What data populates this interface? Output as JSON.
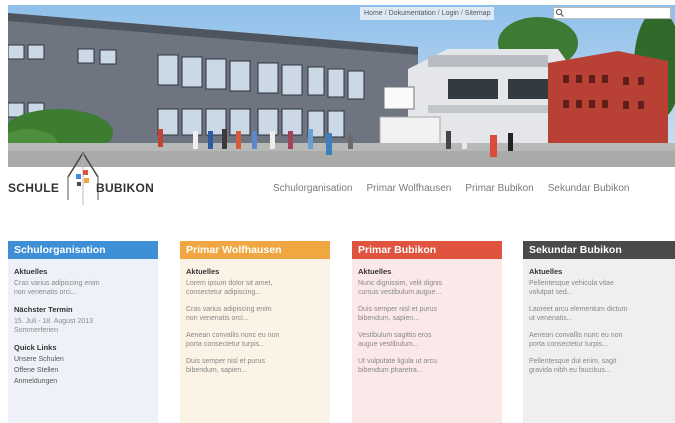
{
  "topnav": {
    "items": [
      "Home",
      "Dokumentation",
      "Login",
      "Sitemap"
    ],
    "separator": "/"
  },
  "search": {
    "placeholder": "",
    "icon": "search-icon"
  },
  "brand": {
    "left": "SCHULE",
    "right": "BUBIKON"
  },
  "mainnav": [
    "Schulorganisation",
    "Primar Wolfhausen",
    "Primar Bubikon",
    "Sekundar Bubikon"
  ],
  "columns": [
    {
      "title": "Schulorganisation",
      "color": "#3e8fd6",
      "sections": [
        {
          "heading": "Aktuelles",
          "lines": [
            "Cras varius adipiscing enim",
            "non venenatis orci..."
          ]
        },
        {
          "heading": "Nächster Termin",
          "lines": [
            "15. Juli - 18. August 2013",
            "Sommerferien"
          ]
        },
        {
          "heading": "Quick Links",
          "lines": [
            "Unsere Schulen",
            "Offene Stellen",
            "Anmeldungen"
          ]
        }
      ]
    },
    {
      "title": "Primar Wolfhausen",
      "color": "#f0a741",
      "sections": [
        {
          "heading": "Aktuelles",
          "lines": [
            "Lorem ipsum dolor sit amet,",
            "consectetur adipiscing..."
          ]
        },
        {
          "heading": "",
          "lines": [
            "Cras varius adipiscing enim",
            "non venenatis orci..."
          ]
        },
        {
          "heading": "",
          "lines": [
            "Aenean convallis nunc eu non",
            "porta consectetur turpis..."
          ]
        },
        {
          "heading": "",
          "lines": [
            "Duis semper nisl et purus",
            "bibendum, sapien..."
          ]
        }
      ]
    },
    {
      "title": "Primar Bubikon",
      "color": "#e0533e",
      "sections": [
        {
          "heading": "Aktuelles",
          "lines": [
            "Nunc dignissim, velit dignis",
            "cursus vestibulum augue..."
          ]
        },
        {
          "heading": "",
          "lines": [
            "Duis semper nisl et purus",
            "bibendum, sapien..."
          ]
        },
        {
          "heading": "",
          "lines": [
            "Vestibulum sagittis eros",
            "augue vestibulum..."
          ]
        },
        {
          "heading": "",
          "lines": [
            "Ut vulputate ligula ut arcu",
            "bibendum pharetra..."
          ]
        }
      ]
    },
    {
      "title": "Sekundar Bubikon",
      "color": "#4a4a4a",
      "sections": [
        {
          "heading": "Aktuelles",
          "lines": [
            "Pellentesque vehicula vitae",
            "volutpat sed..."
          ]
        },
        {
          "heading": "",
          "lines": [
            "Laoreet arcu elementum dictum",
            "ut venenatis..."
          ]
        },
        {
          "heading": "",
          "lines": [
            "Aenean convallis nunc eu non",
            "porta consectetur turpis..."
          ]
        },
        {
          "heading": "",
          "lines": [
            "Pellentesque dui enim, sagit",
            "gravida nibh eu faucibus..."
          ]
        }
      ]
    }
  ]
}
